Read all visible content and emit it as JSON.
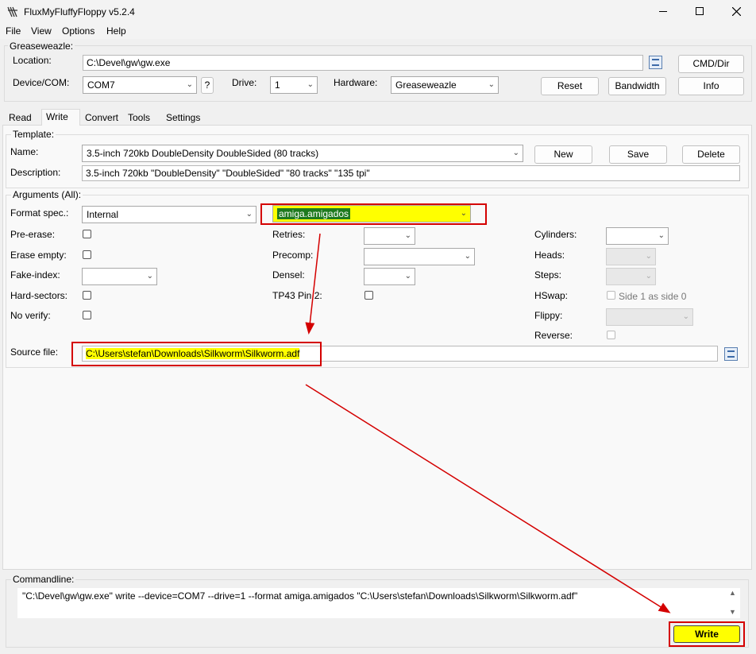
{
  "window": {
    "title": "FluxMyFluffyFloppy v5.2.4",
    "icon": "floppy-app-icon",
    "controls": [
      "minimize",
      "maximize",
      "close"
    ]
  },
  "menu": [
    "File",
    "View",
    "Options",
    "Help"
  ],
  "greaseweazle": {
    "title": "Greaseweazle:",
    "location_label": "Location:",
    "location_value": "C:\\Devel\\gw\\gw.exe",
    "device_label": "Device/COM:",
    "device_value": "COM7",
    "help_button": "?",
    "drive_label": "Drive:",
    "drive_value": "1",
    "hardware_label": "Hardware:",
    "hardware_value": "Greaseweazle",
    "cmd_dir_button": "CMD/Dir",
    "reset_button": "Reset",
    "bandwidth_button": "Bandwidth",
    "info_button": "Info"
  },
  "tabs": [
    {
      "label": "Read",
      "active": false
    },
    {
      "label": "Write",
      "active": true
    },
    {
      "label": "Convert",
      "active": false
    },
    {
      "label": "Tools",
      "active": false
    },
    {
      "label": "Settings",
      "active": false
    }
  ],
  "template": {
    "title": "Template:",
    "name_label": "Name:",
    "name_value": "3.5-inch 720kb DoubleDensity DoubleSided (80 tracks)",
    "new_button": "New",
    "save_button": "Save",
    "delete_button": "Delete",
    "description_label": "Description:",
    "description_value": "3.5-inch 720kb \"DoubleDensity\" \"DoubleSided\" \"80 tracks\" \"135 tpi\""
  },
  "arguments": {
    "title": "Arguments (All):",
    "format_spec_label": "Format spec.:",
    "format_source_value": "Internal",
    "format_value": "amiga.amigados",
    "pre_erase_label": "Pre-erase:",
    "erase_empty_label": "Erase empty:",
    "fake_index_label": "Fake-index:",
    "hard_sectors_label": "Hard-sectors:",
    "no_verify_label": "No verify:",
    "retries_label": "Retries:",
    "precomp_label": "Precomp:",
    "densel_label": "Densel:",
    "tp43_label": "TP43 Pin 2:",
    "cylinders_label": "Cylinders:",
    "heads_label": "Heads:",
    "steps_label": "Steps:",
    "hswap_label": "HSwap:",
    "hswap_option": "Side 1 as side 0",
    "flippy_label": "Flippy:",
    "reverse_label": "Reverse:",
    "source_file_label": "Source file:",
    "source_file_value": "C:\\Users\\stefan\\Downloads\\Silkworm\\Silkworm.adf"
  },
  "commandline": {
    "title": "Commandline:",
    "value": "\"C:\\Devel\\gw\\gw.exe\" write --device=COM7 --drive=1 --format amiga.amigados \"C:\\Users\\stefan\\Downloads\\Silkworm\\Silkworm.adf\"",
    "write_button": "Write"
  },
  "colors": {
    "highlight_yellow": "#ffff00",
    "annotation_red": "#d40000",
    "selection_green": "#1e7a1e"
  }
}
